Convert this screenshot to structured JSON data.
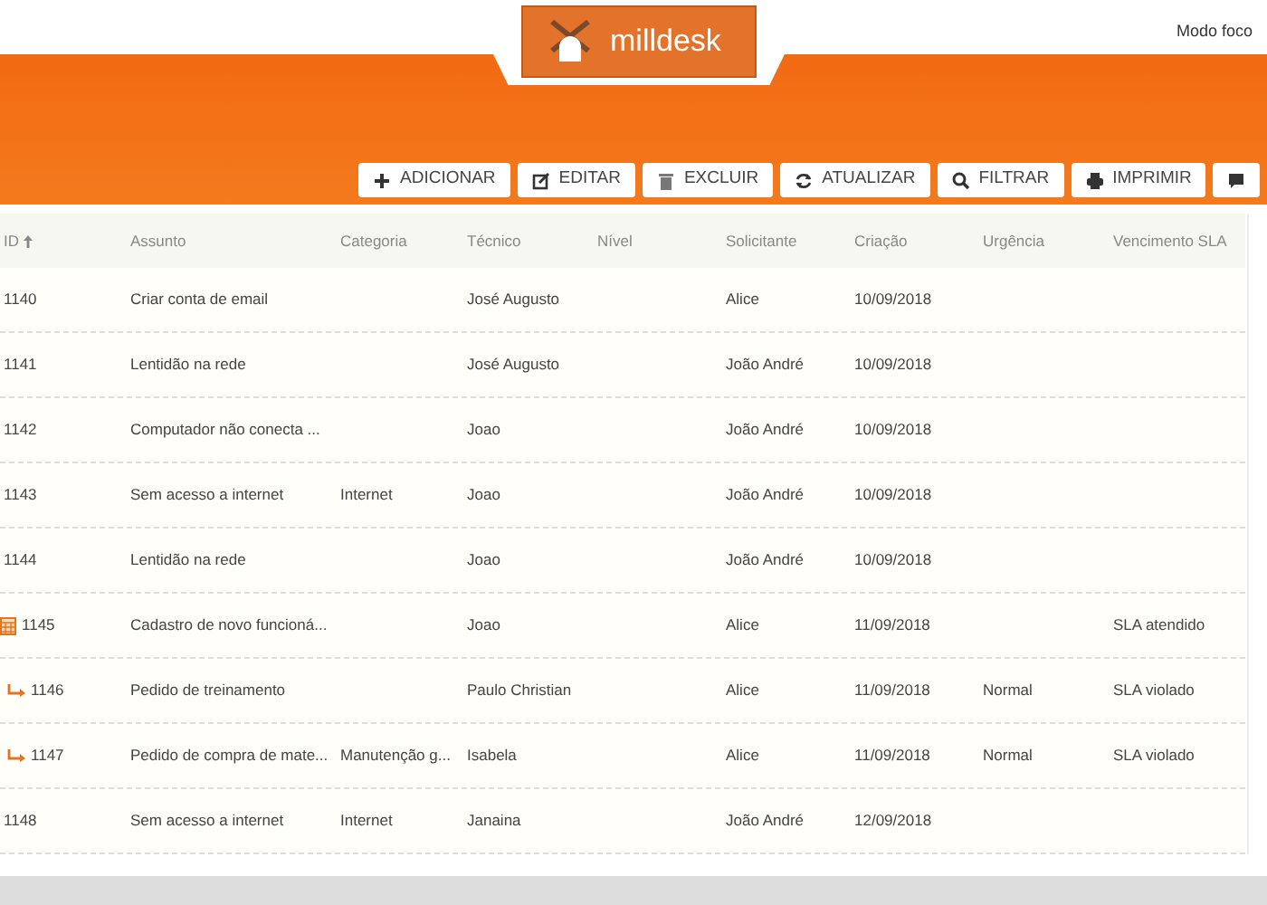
{
  "header": {
    "logo_text": "milldesk",
    "focus_mode": "Modo foco"
  },
  "toolbar": [
    "ADICIONAR",
    "EDITAR",
    "EXCLUIR",
    "ATUALIZAR",
    "FILTRAR",
    "IMPRIMIR"
  ],
  "table": {
    "columns": [
      {
        "label": "ID",
        "sorted": true
      },
      {
        "label": "Assunto",
        "sorted": false
      },
      {
        "label": "Categoria",
        "sorted": false
      },
      {
        "label": "Técnico",
        "sorted": false
      },
      {
        "label": "Nível",
        "sorted": false
      },
      {
        "label": "Solicitante",
        "sorted": false
      },
      {
        "label": "Criação",
        "sorted": false
      },
      {
        "label": "Urgência",
        "sorted": false
      },
      {
        "label": "Vencimento SLA",
        "sorted": false
      }
    ],
    "rows": [
      {
        "kind": "plain",
        "cells": [
          "1140",
          "Criar conta de email",
          "",
          "José Augusto",
          "",
          "Alice",
          "10/09/2018",
          "",
          ""
        ]
      },
      {
        "kind": "plain",
        "cells": [
          "1141",
          "Lentidão na rede",
          "",
          "José Augusto",
          "",
          "João André",
          "10/09/2018",
          "",
          ""
        ]
      },
      {
        "kind": "plain",
        "cells": [
          "1142",
          "Computador não conecta ...",
          "",
          "Joao",
          "",
          "João André",
          "10/09/2018",
          "",
          ""
        ]
      },
      {
        "kind": "plain",
        "cells": [
          "1143",
          "Sem acesso a internet",
          "Internet",
          "Joao",
          "",
          "João André",
          "10/09/2018",
          "",
          ""
        ]
      },
      {
        "kind": "plain",
        "cells": [
          "1144",
          "Lentidão na rede",
          "",
          "Joao",
          "",
          "João André",
          "10/09/2018",
          "",
          ""
        ]
      },
      {
        "kind": "scheduled",
        "cells": [
          "1145",
          "Cadastro de novo funcioná...",
          "",
          "Joao",
          "",
          "Alice",
          "11/09/2018",
          "",
          "SLA atendido"
        ]
      },
      {
        "kind": "subtask",
        "cells": [
          "1146",
          "Pedido de treinamento",
          "",
          "Paulo Christian",
          "",
          "Alice",
          "11/09/2018",
          "Normal",
          "SLA violado"
        ]
      },
      {
        "kind": "subtask",
        "cells": [
          "1147",
          "Pedido de compra de mate...",
          "Manutenção g...",
          "Isabela",
          "",
          "Alice",
          "11/09/2018",
          "Normal",
          "SLA violado"
        ]
      },
      {
        "kind": "plain",
        "cells": [
          "1148",
          "Sem acesso a internet",
          "Internet",
          "Janaina",
          "",
          "João André",
          "12/09/2018",
          "",
          ""
        ]
      }
    ]
  }
}
